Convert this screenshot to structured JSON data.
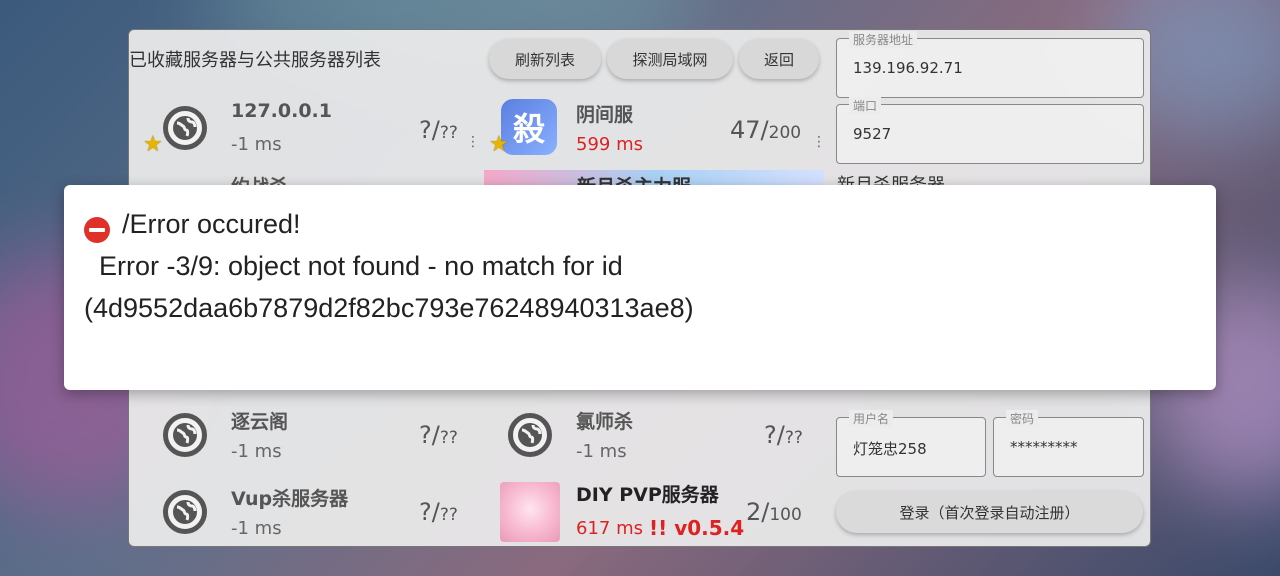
{
  "panel": {
    "title": "已收藏服务器与公共服务器列表",
    "buttons": {
      "refresh": "刷新列表",
      "probe_lan": "探测局域网",
      "back": "返回"
    }
  },
  "servers": [
    {
      "name": "127.0.0.1",
      "ping": "-1 ms",
      "count": "?/",
      "max": "??"
    },
    {
      "name": "阴间服",
      "ping": "599 ms",
      "count": "47/",
      "max": "200"
    },
    {
      "name": "约战杀"
    },
    {
      "name": "新月杀主力服"
    },
    {
      "name": "逐云阁",
      "ping": "-1 ms",
      "count": "?/",
      "max": "??"
    },
    {
      "name": "氯师杀",
      "ping": "-1 ms",
      "count": "?/",
      "max": "??"
    },
    {
      "name": "Vup杀服务器",
      "ping": "-1 ms",
      "count": "?/",
      "max": "??"
    },
    {
      "name": "DIY PVP服务器",
      "ping": "617 ms",
      "version": "!! v0.5.4",
      "count": "2/",
      "max": "100"
    }
  ],
  "form": {
    "address_label": "服务器地址",
    "address_value": "139.196.92.71",
    "port_label": "端口",
    "port_value": "9527",
    "server_name": "新月杀服务器",
    "username_label": "用户名",
    "username_value": "灯笼忠258",
    "password_label": "密码",
    "password_value": "*********",
    "login_button": "登录（首次登录自动注册）"
  },
  "error": {
    "title": "/Error occured!",
    "line1": "Error -3/9: object not found - no match for id",
    "line2": "(4d9552daa6b7879d2f82bc793e76248940313ae8)"
  },
  "colors": {
    "ping_high": "#dd2222",
    "error_icon": "#e0302a"
  }
}
